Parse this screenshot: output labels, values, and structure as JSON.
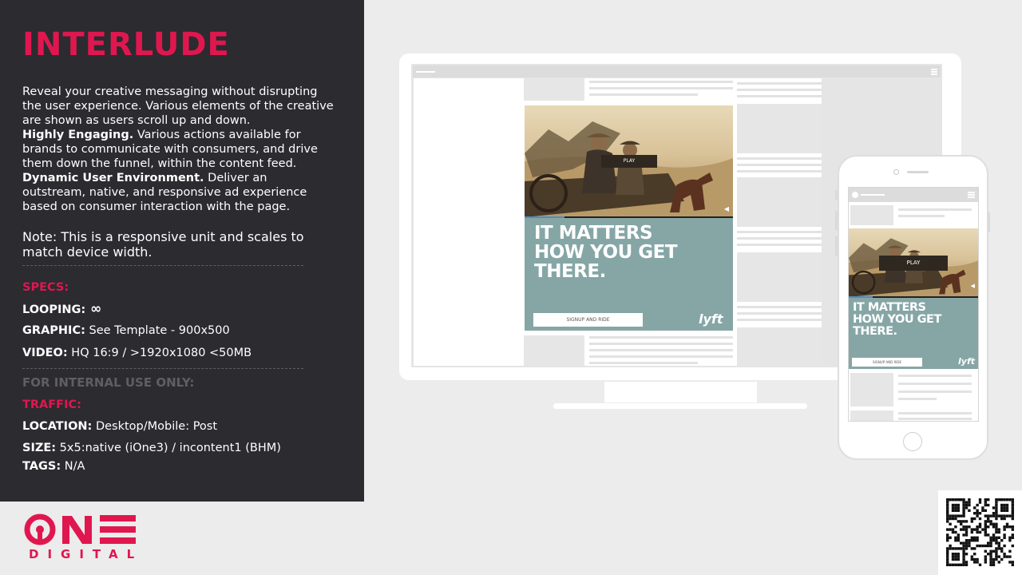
{
  "left": {
    "title": "INTERLUDE",
    "desc_1": "Reveal your creative messaging without disrupting the user experience. Various elements of the creative are shown as users scroll up and down.",
    "desc_2_bold": "Highly Engaging.",
    "desc_2": " Various actions available for brands to communicate with consumers, and drive them down the funnel, within the content feed.",
    "desc_3_bold": "Dynamic User Environment.",
    "desc_3": " Deliver an outstream, native, and responsive ad experience based on consumer interaction with the page.",
    "note": "Note: This is a responsive unit and scales to match device width.",
    "specs_header": "SPECS:",
    "looping_label": "LOOPING:",
    "looping_value": " ∞",
    "graphic_label": "GRAPHIC:",
    "graphic_value": " See Template - 900x500",
    "video_label": "VIDEO:",
    "video_value": " HQ 16:9 / >1920x1080 <50MB",
    "internal_header": "FOR INTERNAL USE ONLY:",
    "traffic_header": "TRAFFIC:",
    "location_label": "LOCATION:",
    "location_value": " Desktop/Mobile: Post",
    "size_label": "SIZE:",
    "size_value": " 5x5:native (iOne3) / incontent1 (BHM)",
    "tags_label": "TAGS:",
    "tags_value": " N/A"
  },
  "logo": {
    "word": "ONE",
    "sub": "DIGITAL"
  },
  "ad": {
    "headline_1": "IT MATTERS",
    "headline_2": "HOW YOU GET",
    "headline_3": "THERE.",
    "play": "PLAY",
    "cta": "SIGNUP AND RIDE",
    "brand": "lyft"
  },
  "colors": {
    "brand_red": "#e0174f",
    "panel_bg": "#2b2b30",
    "ad_teal": "#86a6a6",
    "muted_header": "#5f5f63"
  },
  "icons": [
    "menu-icon",
    "mute-icon",
    "qr-code"
  ]
}
